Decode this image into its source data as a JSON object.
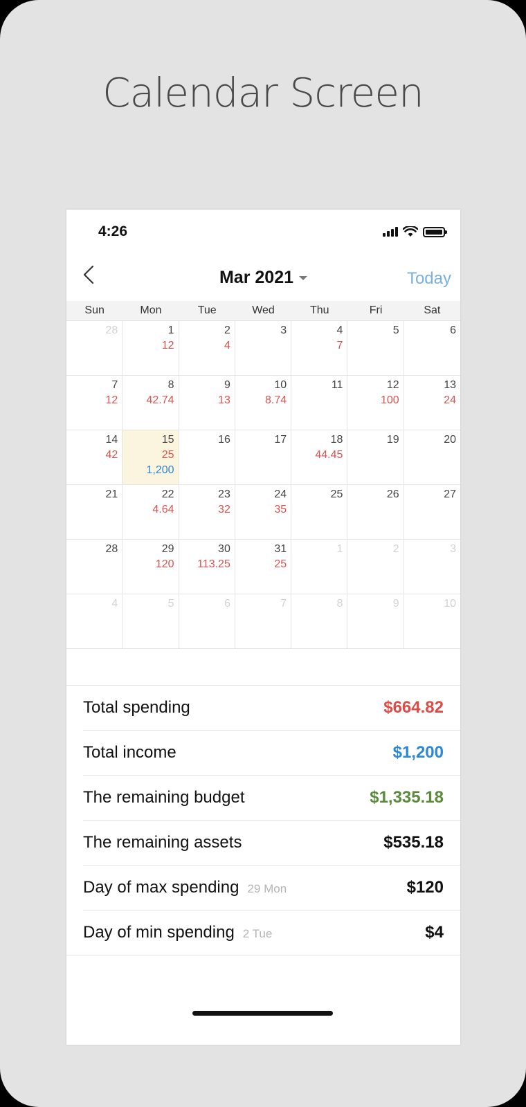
{
  "headline": "Calendar Screen",
  "status": {
    "time": "4:26"
  },
  "nav": {
    "title": "Mar 2021",
    "today": "Today"
  },
  "weekdays": [
    "Sun",
    "Mon",
    "Tue",
    "Wed",
    "Thu",
    "Fri",
    "Sat"
  ],
  "weeks": [
    [
      {
        "day": "28",
        "muted": true
      },
      {
        "day": "1",
        "exp": "12"
      },
      {
        "day": "2",
        "exp": "4"
      },
      {
        "day": "3"
      },
      {
        "day": "4",
        "exp": "7"
      },
      {
        "day": "5"
      },
      {
        "day": "6"
      }
    ],
    [
      {
        "day": "7",
        "exp": "12"
      },
      {
        "day": "8",
        "exp": "42.74"
      },
      {
        "day": "9",
        "exp": "13"
      },
      {
        "day": "10",
        "exp": "8.74"
      },
      {
        "day": "11"
      },
      {
        "day": "12",
        "exp": "100"
      },
      {
        "day": "13",
        "exp": "24"
      }
    ],
    [
      {
        "day": "14",
        "exp": "42"
      },
      {
        "day": "15",
        "exp": "25",
        "inc": "1,200",
        "highlight": true
      },
      {
        "day": "16"
      },
      {
        "day": "17"
      },
      {
        "day": "18",
        "exp": "44.45"
      },
      {
        "day": "19"
      },
      {
        "day": "20"
      }
    ],
    [
      {
        "day": "21"
      },
      {
        "day": "22",
        "exp": "4.64"
      },
      {
        "day": "23",
        "exp": "32"
      },
      {
        "day": "24",
        "exp": "35"
      },
      {
        "day": "25"
      },
      {
        "day": "26"
      },
      {
        "day": "27"
      }
    ],
    [
      {
        "day": "28"
      },
      {
        "day": "29",
        "exp": "120"
      },
      {
        "day": "30",
        "exp": "113.25"
      },
      {
        "day": "31",
        "exp": "25"
      },
      {
        "day": "1",
        "muted": true
      },
      {
        "day": "2",
        "muted": true
      },
      {
        "day": "3",
        "muted": true
      }
    ],
    [
      {
        "day": "4",
        "muted": true
      },
      {
        "day": "5",
        "muted": true
      },
      {
        "day": "6",
        "muted": true
      },
      {
        "day": "7",
        "muted": true
      },
      {
        "day": "8",
        "muted": true
      },
      {
        "day": "9",
        "muted": true
      },
      {
        "day": "10",
        "muted": true
      }
    ]
  ],
  "summary": [
    {
      "label": "Total spending",
      "value": "$664.82",
      "color": "red"
    },
    {
      "label": "Total income",
      "value": "$1,200",
      "color": "blue"
    },
    {
      "label": "The remaining budget",
      "value": "$1,335.18",
      "color": "green"
    },
    {
      "label": "The remaining assets",
      "value": "$535.18",
      "color": "black"
    },
    {
      "label": "Day of max spending",
      "sub": "29 Mon",
      "value": "$120",
      "color": "black"
    },
    {
      "label": "Day of min spending",
      "sub": "2 Tue",
      "value": "$4",
      "color": "black"
    }
  ],
  "colors": {
    "expense": "#dd4b45",
    "income": "#2c87d8",
    "budget": "#5a8b3a",
    "today_accent": "#7ab0e0",
    "highlight": "#fbf4de"
  }
}
